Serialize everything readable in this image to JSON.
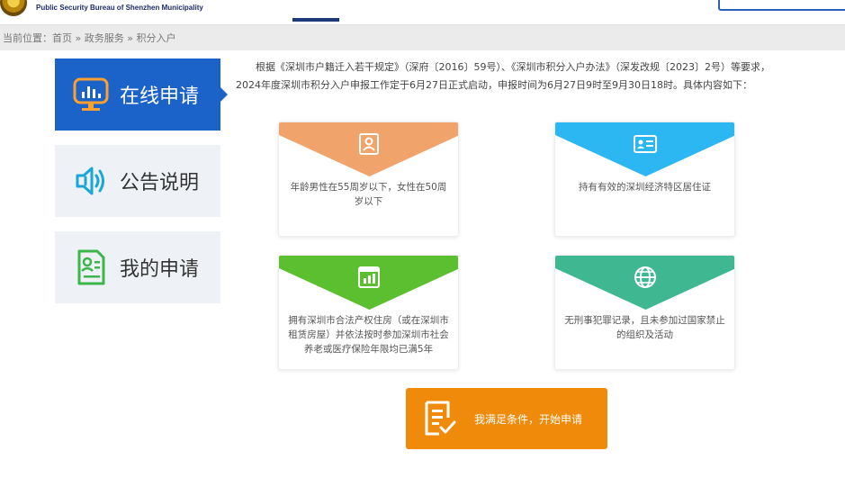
{
  "header": {
    "org_name": "Public Security Bureau of Shenzhen Municipality",
    "search_placeholder": ""
  },
  "breadcrumb": {
    "prefix": "当前位置：",
    "items": [
      "首页",
      "政务服务",
      "积分入户"
    ],
    "separator": "»"
  },
  "sidebar": {
    "items": [
      {
        "label": "在线申请",
        "icon": "monitor-chart-icon",
        "active": true
      },
      {
        "label": "公告说明",
        "icon": "speaker-icon",
        "active": false
      },
      {
        "label": "我的申请",
        "icon": "document-user-icon",
        "active": false
      }
    ]
  },
  "intro": {
    "text": "根据《深圳市户籍迁入若干规定》（深府〔2016〕59号）、《深圳市积分入户办法》（深发改规〔2023〕2号）等要求，2024年度深圳市积分入户申报工作定于6月27日正式启动，申报时间为6月27日9时至9月30日18时。具体内容如下："
  },
  "conditions": [
    {
      "text": "年龄男性在55周岁以下，女性在50周岁以下",
      "color": "#f0a46b",
      "icon": "person-id-icon"
    },
    {
      "text": "持有有效的深圳经济特区居住证",
      "color": "#2cb7f2",
      "icon": "id-card-icon"
    },
    {
      "text": "拥有深圳市合法产权住房（或在深圳市租赁房屋）并依法按时参加深圳市社会养老或医疗保险年限均已满5年",
      "color": "#5cbf2f",
      "icon": "bar-chart-window-icon"
    },
    {
      "text": "无刑事犯罪记录，且未参加过国家禁止的组织及活动",
      "color": "#3fb892",
      "icon": "globe-icon"
    }
  ],
  "apply_button": {
    "label": "我满足条件，开始申请",
    "color": "#ef8a0a",
    "icon": "checklist-icon"
  },
  "colors": {
    "active_tab": "#1b62c9",
    "icon_blue": "#1b62c9",
    "icon_green": "#4caf50",
    "icon_teal": "#19a7d8"
  }
}
